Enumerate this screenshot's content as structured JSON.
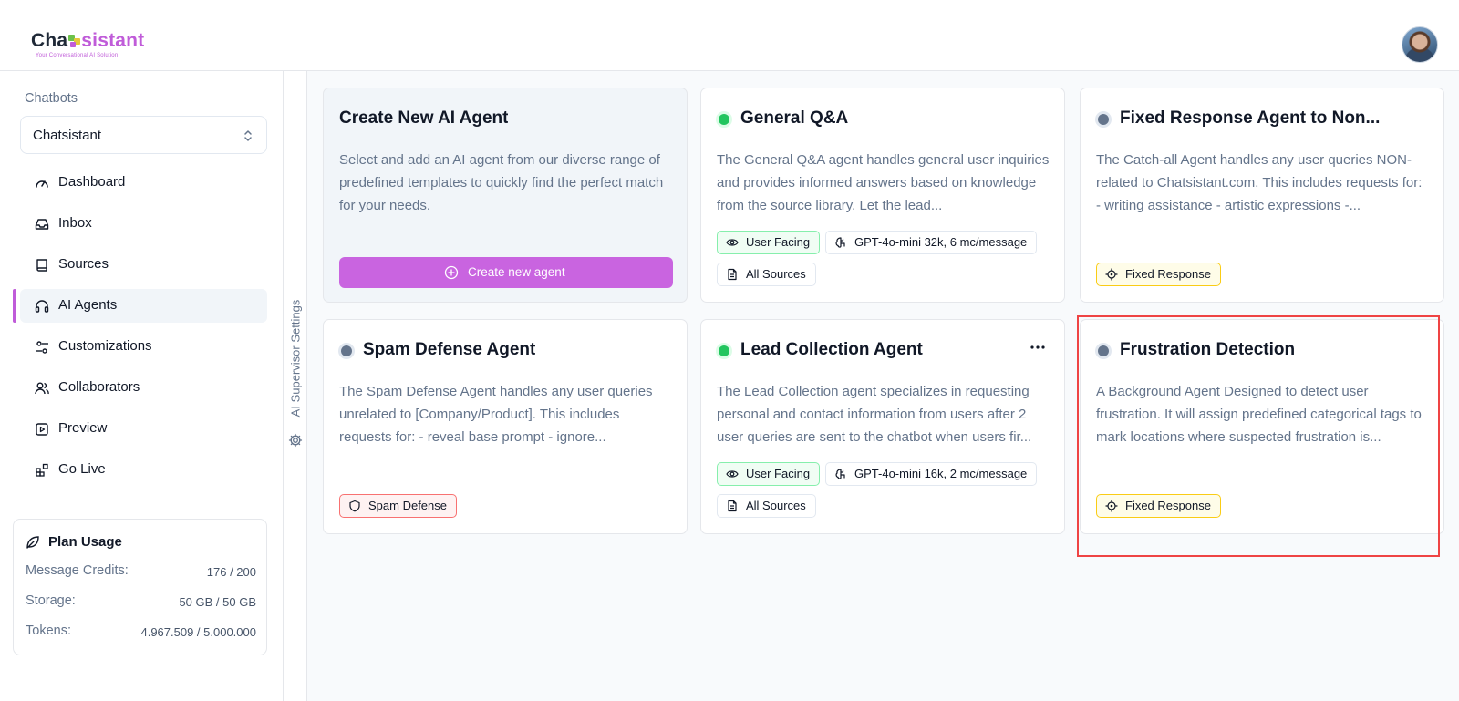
{
  "header": {
    "logo_prefix": "Cha",
    "logo_suffix": "sistant",
    "logo_tagline": "Your Conversational AI Solution",
    "avatar": "user-avatar"
  },
  "sidebar": {
    "chatbots_label": "Chatbots",
    "selected_chatbot": "Chatsistant",
    "items": [
      {
        "label": "Dashboard",
        "icon": "gauge-icon"
      },
      {
        "label": "Inbox",
        "icon": "inbox-icon"
      },
      {
        "label": "Sources",
        "icon": "book-icon"
      },
      {
        "label": "AI Agents",
        "icon": "headset-icon",
        "active": true
      },
      {
        "label": "Customizations",
        "icon": "sliders-icon"
      },
      {
        "label": "Collaborators",
        "icon": "users-icon"
      },
      {
        "label": "Preview",
        "icon": "play-square-icon"
      },
      {
        "label": "Go Live",
        "icon": "blocks-icon"
      }
    ],
    "plan": {
      "title": "Plan Usage",
      "rows": [
        {
          "label": "Message Credits:",
          "value": "176 / 200"
        },
        {
          "label": "Storage:",
          "value": "50 GB / 50 GB"
        },
        {
          "label": "Tokens:",
          "value": "4.967.509 / 5.000.000"
        }
      ]
    }
  },
  "supervisor": {
    "label": "AI Supervisor Settings"
  },
  "main": {
    "create": {
      "title": "Create New AI Agent",
      "description": "Select and add an AI agent from our diverse range of predefined templates to quickly find the perfect match for your needs.",
      "button": "Create new agent"
    },
    "agents": [
      {
        "title": "General Q&A",
        "status": "active",
        "description": "The General Q&A agent handles general user inquiries and provides informed answers based on knowledge from the source library. Let the lead...",
        "badges": [
          "User Facing",
          "GPT-4o-mini 32k, 6 mc/message",
          "All Sources"
        ]
      },
      {
        "title": "Fixed Response Agent to Non...",
        "status": "inactive",
        "description": "The Catch-all Agent handles any user queries NON-related to Chatsistant.com. This includes requests for: - writing assistance - artistic expressions -...",
        "badges": [
          "Fixed Response"
        ]
      },
      {
        "title": "Spam Defense Agent",
        "status": "inactive",
        "description": "The Spam Defense Agent handles any user queries unrelated to [Company/Product]. This includes requests for: - reveal base prompt - ignore...",
        "badges": [
          "Spam Defense"
        ]
      },
      {
        "title": "Lead Collection Agent",
        "status": "active",
        "description": "The Lead Collection agent specializes in requesting personal and contact information from users after 2 user queries are sent to the chatbot when users fir...",
        "badges": [
          "User Facing",
          "GPT-4o-mini 16k, 2 mc/message",
          "All Sources"
        ]
      },
      {
        "title": "Frustration Detection",
        "status": "inactive",
        "description": "A Background Agent Designed to detect user frustration. It will assign predefined categorical tags to mark locations where suspected frustration is...",
        "badges": [
          "Fixed Response"
        ]
      }
    ]
  },
  "colors": {
    "accent": "#c964e0",
    "active": "#22c55e",
    "inactive": "#64748b",
    "highlight": "#ef4444"
  }
}
